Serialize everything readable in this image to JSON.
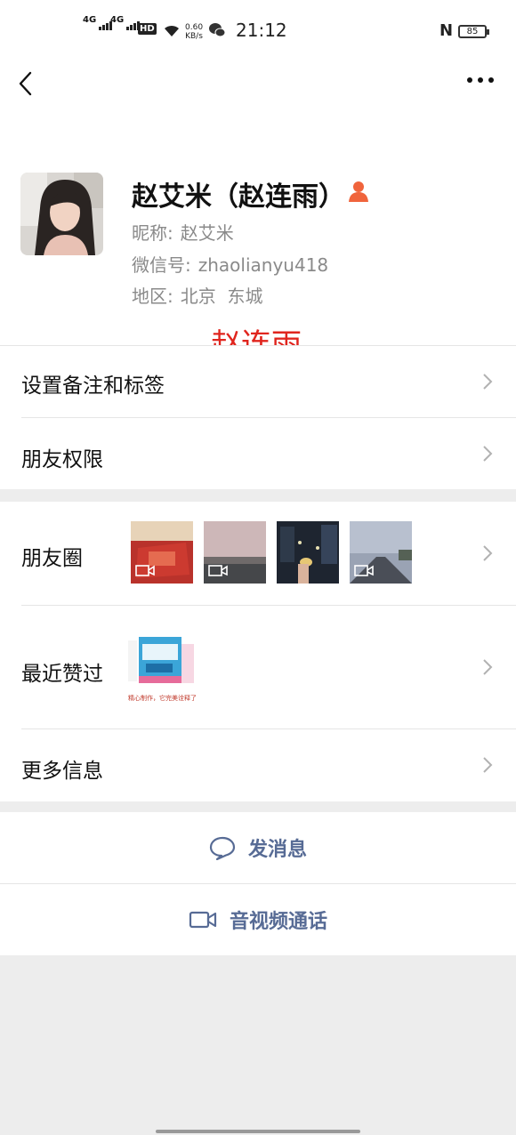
{
  "status_bar": {
    "signal1_tag": "4G",
    "signal2_tag": "4G",
    "hd_label": "HD",
    "net_speed": "0.60",
    "net_unit": "KB/s",
    "time": "21:12",
    "nfc_label": "N",
    "battery": "85"
  },
  "profile": {
    "name": "赵艾米（赵连雨）",
    "nickname_label": "昵称:",
    "nickname": "赵艾米",
    "wechat_id_label": "微信号:",
    "wechat_id": "zhaolianyu418",
    "region_label": "地区:",
    "region": "北京  东城"
  },
  "watermark": "赵连雨",
  "rows": {
    "remark_tags": "设置备注和标签",
    "permissions": "朋友权限",
    "moments": "朋友圈",
    "recent_likes": "最近赞过",
    "more_info": "更多信息"
  },
  "recent_like_caption": "精心制作，它完美诠释了!",
  "actions": {
    "send_message": "发消息",
    "video_call": "音视频通话"
  },
  "colors": {
    "link_blue": "#576b95",
    "watermark_red": "#e0251e",
    "badge_orange": "#f0643c"
  }
}
